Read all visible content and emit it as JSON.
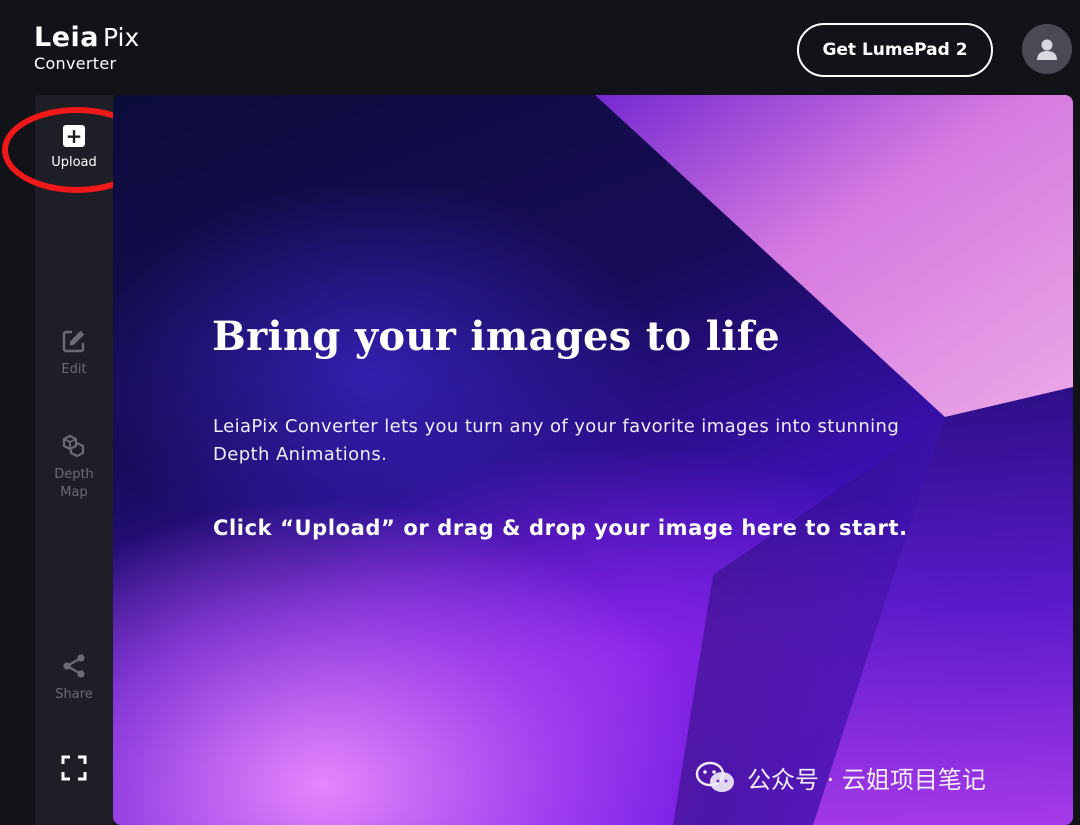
{
  "header": {
    "logo_brand": "Leia",
    "logo_product": "Pix",
    "logo_subtitle": "Converter",
    "cta_label": "Get LumePad 2",
    "avatar_icon": "user-icon"
  },
  "sidebar": {
    "items": [
      {
        "label": "Upload",
        "icon": "plus-square-icon",
        "active": true
      },
      {
        "label": "Edit",
        "icon": "edit-icon",
        "active": false
      },
      {
        "label": "Depth Map",
        "icon": "cubes-icon",
        "active": false
      },
      {
        "label": "Share",
        "icon": "share-icon",
        "active": false
      },
      {
        "label": "",
        "icon": "fullscreen-icon",
        "active": false
      }
    ],
    "highlight_color": "#f01818"
  },
  "main": {
    "headline": "Bring your images to life",
    "description": "LeiaPix Converter lets you turn any of your favorite images into stunning Depth Animations.",
    "instruction": "Click “Upload” or drag & drop your image here to start."
  },
  "watermark": {
    "text": "公众号 · 云姐项目笔记",
    "icon": "wechat-icon"
  },
  "colors": {
    "background": "#121219",
    "sidebar": "#1e1e26",
    "accent_purple": "#8a28ee",
    "text": "#ffffff"
  }
}
